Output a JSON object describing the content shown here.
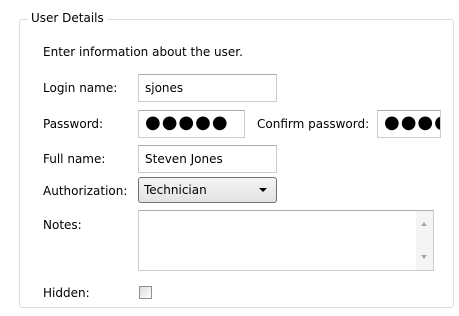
{
  "group": {
    "title": "User Details",
    "description": "Enter information about the user."
  },
  "login": {
    "label": "Login name:",
    "value": "sjones"
  },
  "password": {
    "label": "Password:",
    "value": "●●●●●"
  },
  "confirm_password": {
    "label": "Confirm password:",
    "value": "●●●●●"
  },
  "full_name": {
    "label": "Full name:",
    "value": "Steven Jones"
  },
  "authorization": {
    "label": "Authorization:",
    "selected": "Technician"
  },
  "notes": {
    "label": "Notes:",
    "value": ""
  },
  "hidden": {
    "label": "Hidden:",
    "checked": false
  },
  "icons": {
    "dropdown": "chevron-down-icon",
    "scroll_up": "scroll-up-arrow-icon",
    "scroll_down": "scroll-down-arrow-icon"
  },
  "colors": {
    "groupbox_border": "#d5dfe5",
    "field_border": "#c9cdd2",
    "combo_border": "#707070"
  }
}
